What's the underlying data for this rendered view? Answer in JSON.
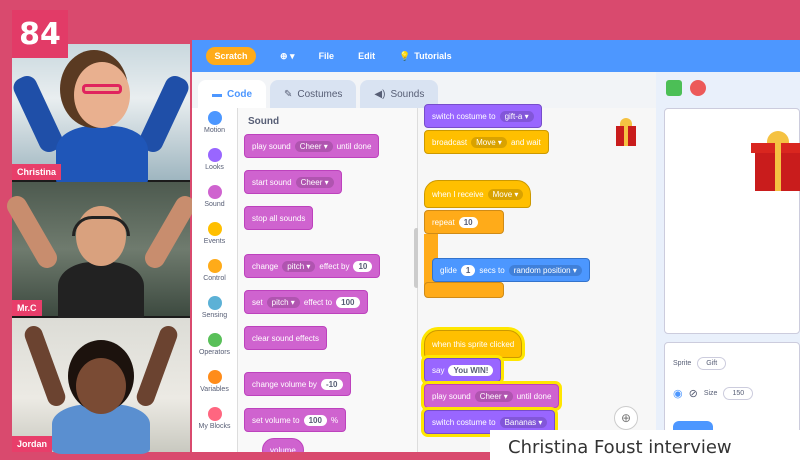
{
  "page_number": "84",
  "caption": "Christina Foust interview",
  "participants": [
    {
      "name": "Christina"
    },
    {
      "name": "Mr.C"
    },
    {
      "name": "Jordan"
    }
  ],
  "menubar": {
    "logo": "Scratch",
    "file": "File",
    "edit": "Edit",
    "tutorials": "Tutorials"
  },
  "tabs": {
    "code": "Code",
    "costumes": "Costumes",
    "sounds": "Sounds"
  },
  "categories": [
    {
      "label": "Motion",
      "color": "#4c97ff"
    },
    {
      "label": "Looks",
      "color": "#9966ff"
    },
    {
      "label": "Sound",
      "color": "#cf63cf"
    },
    {
      "label": "Events",
      "color": "#ffbf00"
    },
    {
      "label": "Control",
      "color": "#ffab19"
    },
    {
      "label": "Sensing",
      "color": "#5cb1d6"
    },
    {
      "label": "Operators",
      "color": "#59c059"
    },
    {
      "label": "Variables",
      "color": "#ff8c1a"
    },
    {
      "label": "My Blocks",
      "color": "#ff6680"
    }
  ],
  "palette": {
    "heading": "Sound",
    "play_sound": "play sound",
    "play_sound_value": "Cheer ▾",
    "until_done": "until done",
    "start_sound": "start sound",
    "start_sound_value": "Cheer ▾",
    "stop_all": "stop all sounds",
    "change": "change",
    "change_effect": "pitch ▾",
    "effect_by": "effect by",
    "effect_by_value": "10",
    "set": "set",
    "set_effect": "pitch ▾",
    "effect_to": "effect to",
    "effect_to_value": "100",
    "clear_effects": "clear sound effects",
    "change_volume": "change volume by",
    "change_volume_value": "-10",
    "set_volume": "set volume to",
    "set_volume_value": "100",
    "set_volume_unit": "%",
    "volume": "volume"
  },
  "script1": {
    "switch_costume": "switch costume to",
    "switch_costume_value": "gift-a ▾",
    "broadcast": "broadcast",
    "broadcast_value": "Move ▾",
    "and_wait": "and wait"
  },
  "script2": {
    "when_receive": "when I receive",
    "when_receive_value": "Move ▾",
    "repeat": "repeat",
    "repeat_value": "10",
    "glide": "glide",
    "glide_value": "1",
    "secs_to": "secs to",
    "glide_target": "random position ▾"
  },
  "script3": {
    "when_clicked": "when this sprite clicked",
    "say": "say",
    "say_value": "You WIN!",
    "play_sound": "play sound",
    "play_sound_value": "Cheer ▾",
    "until_done": "until done",
    "switch_costume": "switch costume to",
    "switch_costume_value": "Bananas ▾"
  },
  "sprite_panel": {
    "sprite_label": "Sprite",
    "sprite_name": "Gift",
    "size_label": "Size",
    "size_value": "150"
  },
  "icons": {
    "flag": "green-flag-icon",
    "stop": "stop-icon",
    "zoom": "zoom-in-icon"
  },
  "colors": {
    "brand_pink": "#e23b67",
    "scratch_blue": "#4d97ff"
  }
}
